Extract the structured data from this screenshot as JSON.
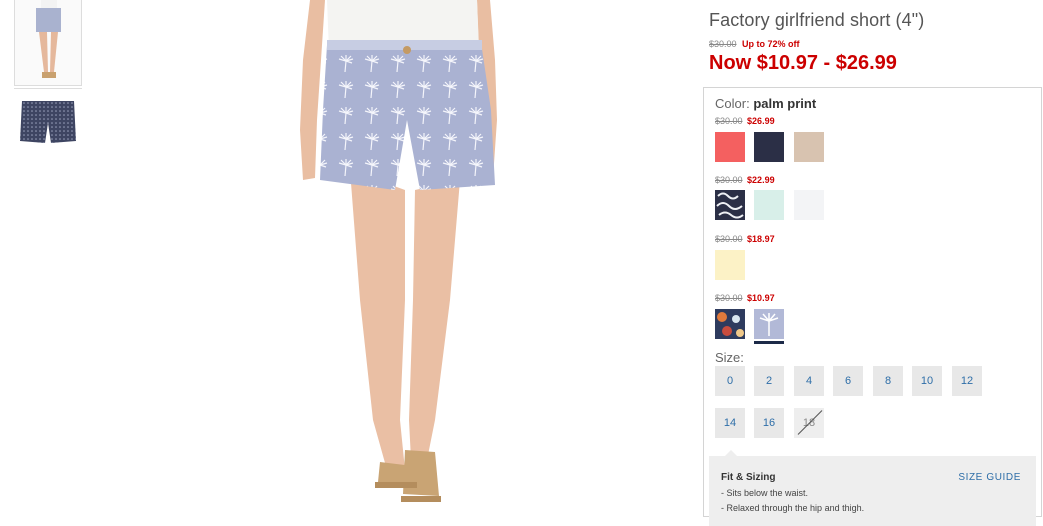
{
  "product": {
    "title": "Factory girlfriend short (4\")",
    "original_price": "$30.00",
    "discount_text": "Up to 72% off",
    "now_price": "Now $10.97 - $26.99"
  },
  "color": {
    "label": "Color:",
    "selected": "palm print",
    "groups": [
      {
        "original": "$30.00",
        "price": "$26.99",
        "swatches": [
          "#f46060",
          "#2b2f46",
          "#d8c3b0"
        ]
      },
      {
        "original": "$30.00",
        "price": "$22.99",
        "swatches": [
          "pattern-navy-white",
          "#d8efe9",
          "#f3f4f6"
        ]
      },
      {
        "original": "$30.00",
        "price": "$18.97",
        "swatches": [
          "#fcf2c6"
        ]
      },
      {
        "original": "$30.00",
        "price": "$10.97",
        "swatches": [
          "pattern-multicolor",
          "pattern-palm-print"
        ]
      }
    ]
  },
  "size": {
    "label": "Size:",
    "options": [
      "0",
      "2",
      "4",
      "6",
      "8",
      "10",
      "12",
      "14",
      "16",
      "18"
    ],
    "unavailable": [
      "18"
    ]
  },
  "fit": {
    "title": "Fit & Sizing",
    "size_guide_label": "SIZE GUIDE",
    "bullets": [
      "- Sits below the waist.",
      "- Relaxed through the hip and thigh."
    ]
  },
  "colors": {
    "price_red": "#cc0000",
    "link_blue": "#2e6ea8",
    "selected_indicator": "#1c2a48"
  }
}
